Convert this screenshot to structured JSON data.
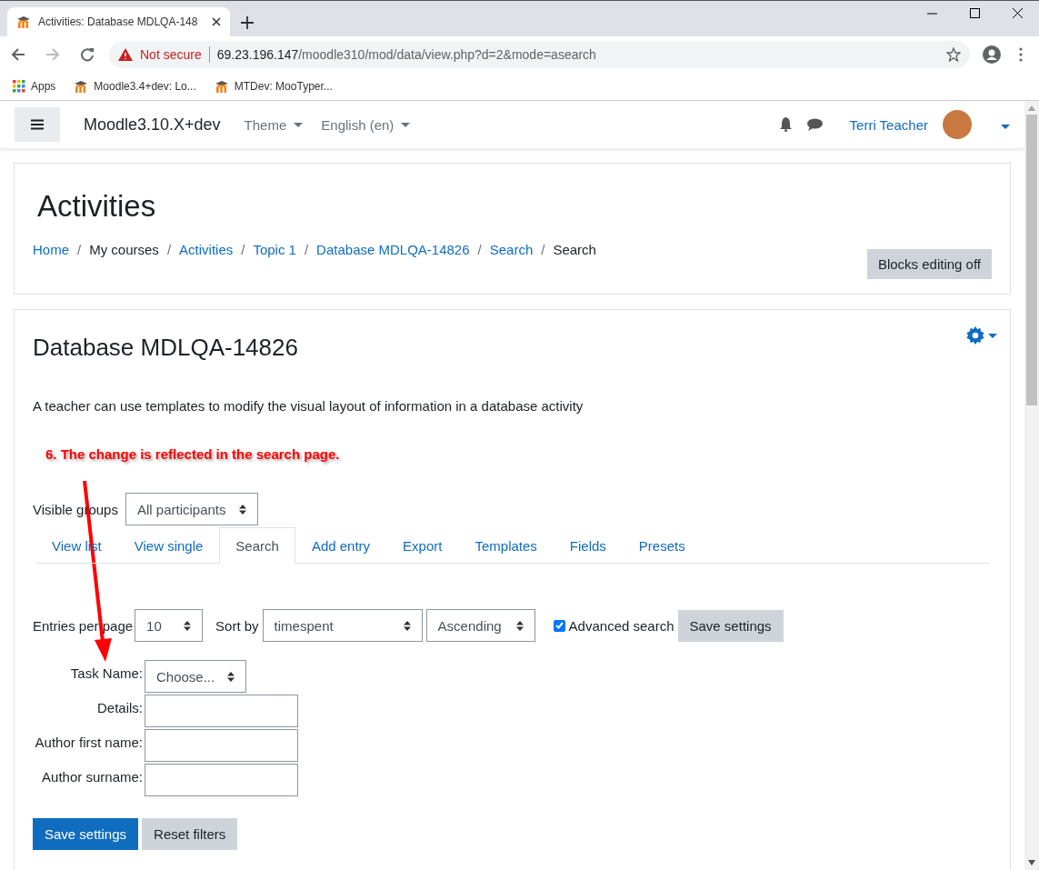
{
  "browser": {
    "tab_title": "Activities: Database MDLQA-148",
    "url_warning": "Not secure",
    "url_host": "69.23.196.147",
    "url_path": "/moodle310/mod/data/view.php?d=2&mode=asearch",
    "bookmarks": [
      {
        "label": "Apps",
        "kind": "apps"
      },
      {
        "label": "Moodle3.4+dev: Lo...",
        "kind": "site"
      },
      {
        "label": "MTDev: MooTyper...",
        "kind": "site"
      }
    ]
  },
  "navbar": {
    "brand": "Moodle3.10.X+dev",
    "menus": [
      "Theme",
      "English (en)"
    ],
    "user_name": "Terri Teacher"
  },
  "header": {
    "title": "Activities",
    "breadcrumbs": [
      {
        "label": "Home",
        "link": true
      },
      {
        "label": "My courses",
        "link": false
      },
      {
        "label": "Activities",
        "link": true
      },
      {
        "label": "Topic 1",
        "link": true
      },
      {
        "label": "Database MDLQA-14826",
        "link": true
      },
      {
        "label": "Search",
        "link": true
      },
      {
        "label": "Search",
        "link": false
      }
    ],
    "separator": "/",
    "button": "Blocks editing off"
  },
  "main": {
    "title": "Database MDLQA-14826",
    "description": "A teacher can use templates to modify the visual layout of information in a database activity",
    "annotation": "6. The change is reflected in the search page.",
    "visible_groups": {
      "label": "Visible groups",
      "value": "All participants"
    },
    "tabs": [
      {
        "label": "View list",
        "selected": false
      },
      {
        "label": "View single",
        "selected": false
      },
      {
        "label": "Search",
        "selected": true
      },
      {
        "label": "Add entry",
        "selected": false
      },
      {
        "label": "Export",
        "selected": false
      },
      {
        "label": "Templates",
        "selected": false
      },
      {
        "label": "Fields",
        "selected": false
      },
      {
        "label": "Presets",
        "selected": false
      }
    ],
    "entries_per_page": {
      "label": "Entries per page",
      "value": "10"
    },
    "sort_by": {
      "label": "Sort by",
      "field": "timespent",
      "order": "Ascending"
    },
    "advanced_search": {
      "label": "Advanced search",
      "checked": true
    },
    "settings_button": "Save settings",
    "fields": [
      {
        "label": "Task Name:",
        "kind": "select",
        "value": "Choose..."
      },
      {
        "label": "Details:",
        "kind": "text"
      },
      {
        "label": "Author first name:",
        "kind": "text"
      },
      {
        "label": "Author surname:",
        "kind": "text"
      }
    ],
    "buttons": [
      {
        "label": "Save settings",
        "kind": "primary"
      },
      {
        "label": "Reset filters",
        "kind": "secondary"
      }
    ]
  }
}
